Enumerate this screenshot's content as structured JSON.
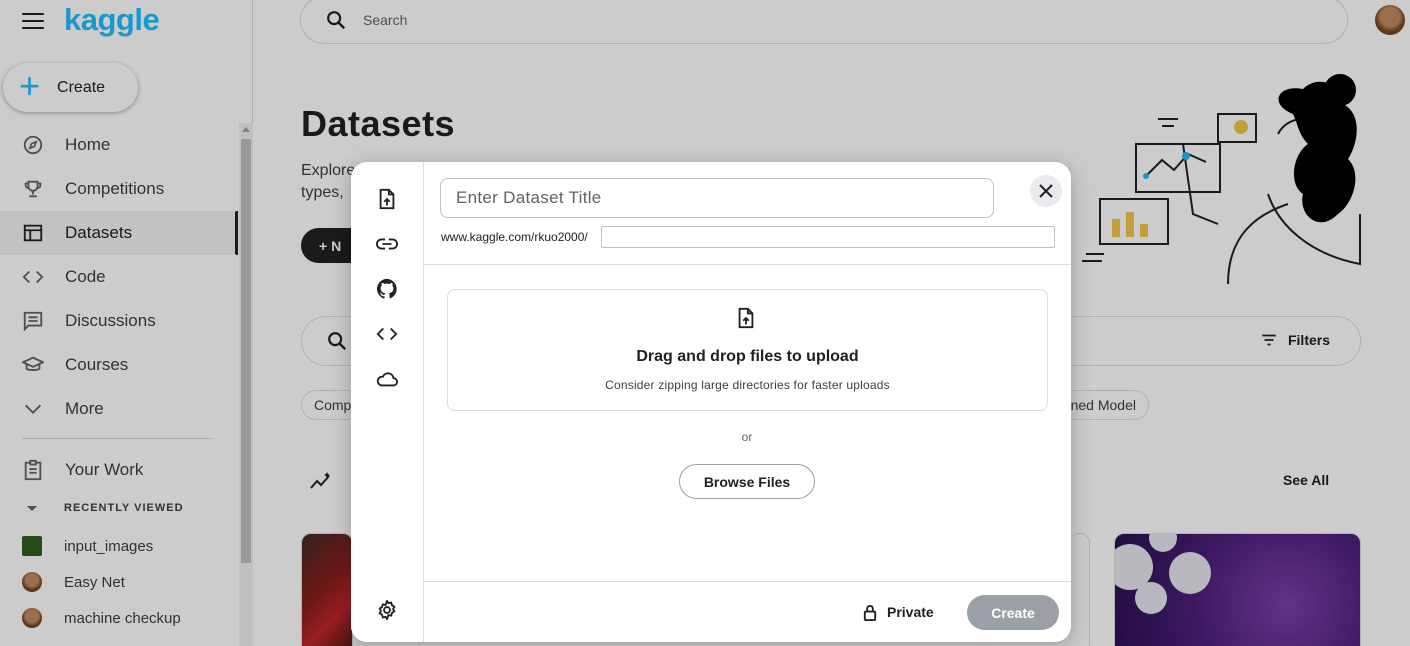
{
  "app": {
    "logo": "kaggle"
  },
  "sidebar": {
    "create_label": "Create",
    "nav": [
      {
        "label": "Home",
        "icon": "compass-icon"
      },
      {
        "label": "Competitions",
        "icon": "trophy-icon"
      },
      {
        "label": "Datasets",
        "icon": "table-icon",
        "active": true
      },
      {
        "label": "Code",
        "icon": "code-icon"
      },
      {
        "label": "Discussions",
        "icon": "comment-icon"
      },
      {
        "label": "Courses",
        "icon": "school-icon"
      },
      {
        "label": "More",
        "icon": "chevron-down-icon"
      }
    ],
    "your_work": "Your Work",
    "recently_viewed_label": "RECENTLY VIEWED",
    "recent": [
      "input_images",
      "Easy Net",
      "machine checkup"
    ]
  },
  "header": {
    "search_placeholder": "Search"
  },
  "page": {
    "title": "Datasets",
    "subtitle_line1": "Explore",
    "subtitle_line2": "types,",
    "new_dataset_label": "+ N",
    "filters_label": "Filters",
    "chips": [
      "Comp",
      "ned Model"
    ],
    "see_all": "See All"
  },
  "modal": {
    "title_placeholder": "Enter Dataset Title",
    "url_prefix": "www.kaggle.com/rkuo2000/",
    "slug_value": "",
    "rail_icons": [
      "upload-file-icon",
      "link-icon",
      "github-icon",
      "code-icon",
      "cloud-icon",
      "settings-icon"
    ],
    "dropzone_title": "Drag and drop files to upload",
    "dropzone_subtitle": "Consider zipping large directories for faster uploads",
    "or_text": "or",
    "browse_label": "Browse Files",
    "visibility_label": "Private",
    "create_label": "Create"
  },
  "colors": {
    "brand": "#20beff",
    "text": "#202124",
    "disabled_button": "#9aa0a6"
  }
}
